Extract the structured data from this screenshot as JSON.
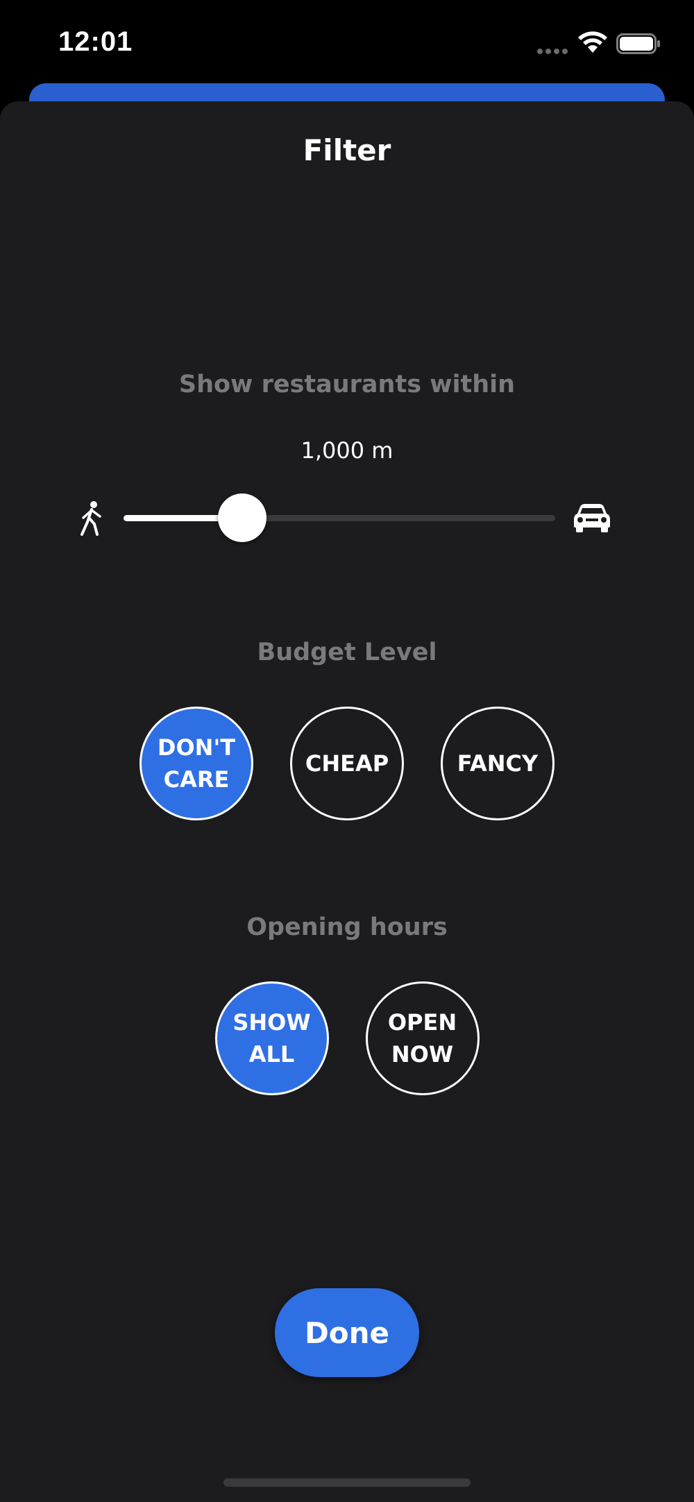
{
  "status_bar": {
    "time": "12:01"
  },
  "sheet": {
    "title": "Filter"
  },
  "distance": {
    "label": "Show restaurants within",
    "value": "1,000 m",
    "slider_fraction": 0.275,
    "min_icon": "walk-icon",
    "max_icon": "car-icon"
  },
  "budget": {
    "label": "Budget Level",
    "options": [
      {
        "label": "DON'T CARE",
        "selected": true
      },
      {
        "label": "CHEAP",
        "selected": false
      },
      {
        "label": "FANCY",
        "selected": false
      }
    ]
  },
  "opening_hours": {
    "label": "Opening hours",
    "options": [
      {
        "label": "SHOW ALL",
        "selected": true
      },
      {
        "label": "OPEN NOW",
        "selected": false
      }
    ]
  },
  "done_label": "Done",
  "colors": {
    "accent": "#2f6fe4",
    "sheet_background": "#1c1c1e",
    "section_label": "#7a7a7c"
  }
}
